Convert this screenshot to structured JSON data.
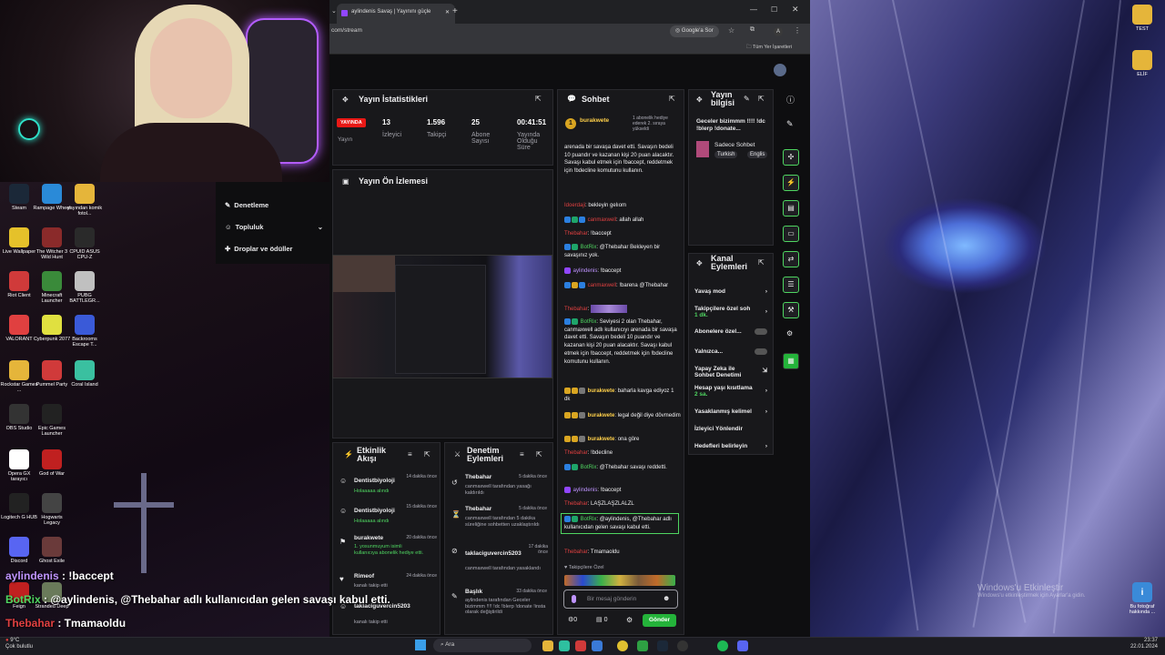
{
  "browser": {
    "tab_title": "aylindenis Savaş | Yayınını güçle",
    "url": "com/stream",
    "google_lens": "Google'a Sor",
    "bookmarks_label": "Tüm Yer İşaretleri"
  },
  "stream_stats": {
    "title": "Yayın İstatistikleri",
    "live_badge": "YAYINDA",
    "live_label": "Yayın",
    "viewers_value": "13",
    "viewers_label": "İzleyici",
    "followers_value": "1.596",
    "followers_label": "Takipçi",
    "subs_value": "25",
    "subs_label": "Abone Sayısı",
    "uptime_value": "00:41:51",
    "uptime_label": "Yayında Olduğu Süre"
  },
  "preview": {
    "title": "Yayın Ön İzlemesi"
  },
  "left_menu": {
    "item1": "Denetleme",
    "item2": "Topluluk",
    "item3": "Droplar ve ödüller"
  },
  "chat": {
    "title": "Sohbet",
    "pinned_user": "burakwete",
    "pinned_text": "1 abonelik hediye ederek 2. sıraya yükseldi",
    "lines": [
      "arenada bir savaşa davet etti. Savaşın bedeli 10 puandır ve kazanan kişi 20 puan alacaktır. Savaşı kabul etmek için !baccept, reddetmek için !bdecline komutunu kullanın.",
      "bekleyin gelıom",
      "allah allah",
      "!baccept",
      "@Thebahar Bekleyen bir savaşınız yok.",
      "!baccept",
      "!barena @Thebahar",
      "Seviyesi 2 olan Thebahar, canmaxwell adlı kullanıcıyı arenada bir savaşa davet etti. Savaşın bedeli 10 puandır ve kazanan kişi 20 puan alacaktır. Savaşı kabul etmek için !baccept, reddetmek için !bdecline komutunu kullanın.",
      "baharla kavga ediyoz 1 dk",
      "legal değil diye dövmedim",
      "ona göre",
      "!bdecline",
      "@Thebahar savaşı reddetti.",
      "!baccept",
      "LAŞZLAŞZLALZL",
      "@aylindenis, @Thebahar adlı kullanıcıdan gelen savaşı kabul etti.",
      "Tmamaoldu"
    ],
    "users": {
      "mod1": "Idoerdaji",
      "user_canmax": "canmaxwell",
      "thebahar": "Thebahar",
      "botrix": "BotRix",
      "aylindenis": "aylindenis",
      "burakwete": "burakwete"
    },
    "follower_only": "Takipçilere Özel",
    "input_placeholder": "Bir mesaj gönderin",
    "send_button": "Gönder",
    "points": "0",
    "ch": "0"
  },
  "stream_info": {
    "title": "Yayın bilgisi",
    "stream_title": "Geceler bizimmm !!!! !dc !blerp !donate...",
    "category": "Sadece Sohbet",
    "tag1": "Turkish",
    "tag2": "Englis"
  },
  "channel_actions": {
    "title": "Kanal Eylemleri",
    "slow_mode": "Yavaş mod",
    "followers_chat": "Takipçilere özel soh",
    "followers_chat_sub": "1 dk.",
    "subs_only": "Abonelere özel...",
    "alone": "Yalnızca...",
    "ai_moderation": "Yapay Zeka ile Sohbet Denetimi",
    "account_limits": "Hesap yaşı kısıtlama",
    "account_limits_sub": "2 sa.",
    "banned_words": "Yasaklanmış kelimel",
    "viewer_redirect": "İzleyici Yönlendir",
    "goals": "Hedefleri belirleyin"
  },
  "activity": {
    "title": "Etkinlik Akışı",
    "items": [
      {
        "name": "Dentistbiyoloji",
        "sub": "Holaaaaa alındı",
        "time": "14 dakika önce"
      },
      {
        "name": "Dentistbiyoloji",
        "sub": "Holaaaaa alındı",
        "time": "15 dakika önce"
      },
      {
        "name": "burakwete",
        "sub": "1. yosunmuyum isimli kullanıcıya abonelik hediye etti.",
        "time": "20 dakika önce"
      },
      {
        "name": "Rimeof",
        "sub": "kanalı takip etti",
        "time": "24 dakika önce"
      },
      {
        "name": "taklaciguvercin5203",
        "sub": "kanalı takip etti",
        "time": ""
      }
    ]
  },
  "mod_actions": {
    "title": "Denetim Eylemleri",
    "items": [
      {
        "name": "Thebahar",
        "sub": "canmaxwell tarafından yasağı kaldırıldı",
        "time": "5 dakika önce"
      },
      {
        "name": "Thebahar",
        "sub": "canmaxwell tarafından 5 dakika süreliğine sohbetten uzaklaştırıldı",
        "time": "5 dakika önce"
      },
      {
        "name": "taklaciguvercin5203",
        "sub": "canmaxwell tarafından yasaklandı",
        "time": "17 dakika önce"
      },
      {
        "name": "Başlık",
        "sub": "aylindenis tarafından Geceler bizimmm !!!! !dc !blerp !donate !insta olarak değiştirildi",
        "time": "33 dakika önce"
      }
    ]
  },
  "overlay_chat": {
    "line1_user": "aylindenis",
    "line1_text": " : !baccept",
    "line2_user": "BotRix",
    "line2_text": " : @aylindenis, @Thebahar adlı kullanıcıdan gelen savaşı kabul etti.",
    "line3_user": "Thebahar",
    "line3_text": " : Tmamaoldu"
  },
  "desktop_icons": [
    "Steam",
    "Rampage Wheel",
    "yayından komik fotol...",
    "Live Wallpaper",
    "The Witcher 3 Wild Hunt",
    "CPUID ASUS CPU-Z",
    "Riot Client",
    "Minecraft Launcher",
    "PUBG BATTLEGR...",
    "VALORANT",
    "Cyberpunk 2077",
    "Backrooms Escape T...",
    "Rockstar Games ...",
    "Pummel Party",
    "Coral Island",
    "OBS Studio",
    "Epic Games Launcher",
    "Opera GX tarayıcı",
    "God of War",
    "Logitech G HUB",
    "Hogwarts Legacy",
    "Discord",
    "Ghost Exile",
    "Feign",
    "Stranded Deep"
  ],
  "desktop_right_icons": [
    "TEST",
    "ELİF",
    "Bu fotoğraf hakkında ..."
  ],
  "windows_watermark": {
    "line1": "Windows'u Etkinleştir",
    "line2": "Windows'u etkinleştirmek için Ayarlar'a gidin."
  },
  "taskbar": {
    "weather_temp": "9°C",
    "weather_text": "Çok bulutlu",
    "search": "Ara",
    "time": "23:37",
    "date": "22.01.2024"
  }
}
